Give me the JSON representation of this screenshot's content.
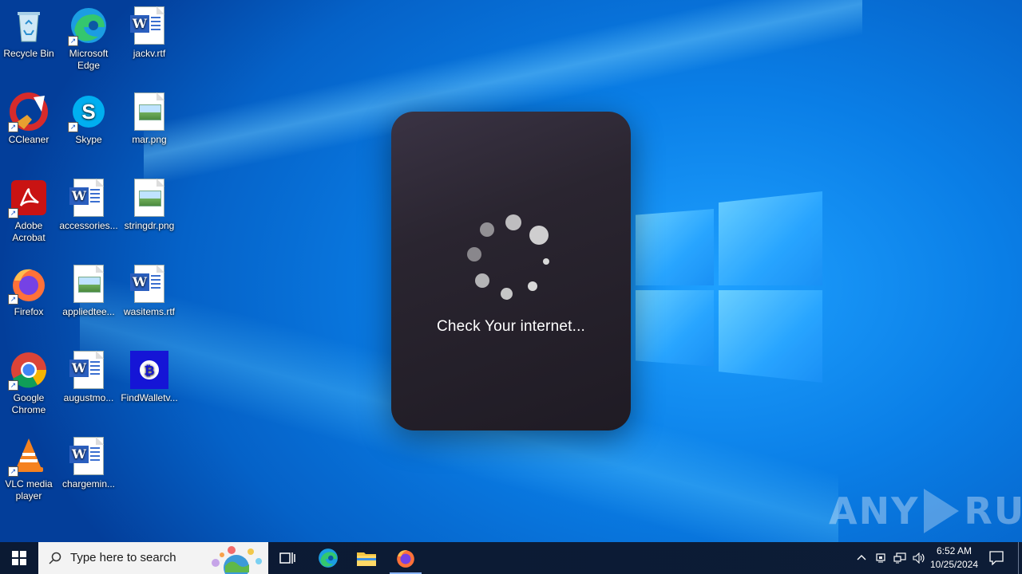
{
  "desktop": {
    "icons": [
      {
        "label": "Recycle Bin"
      },
      {
        "label": "Microsoft Edge"
      },
      {
        "label": "jackv.rtf"
      },
      {
        "label": "CCleaner"
      },
      {
        "label": "Skype"
      },
      {
        "label": "mar.png"
      },
      {
        "label": "Adobe Acrobat"
      },
      {
        "label": "accessories..."
      },
      {
        "label": "stringdr.png"
      },
      {
        "label": "Firefox"
      },
      {
        "label": "appliedtee..."
      },
      {
        "label": "wasitems.rtf"
      },
      {
        "label": "Google Chrome"
      },
      {
        "label": "augustmo..."
      },
      {
        "label": "FindWalletv..."
      },
      {
        "label": "VLC media player"
      },
      {
        "label": "chargemin..."
      }
    ]
  },
  "dialog": {
    "message": "Check Your internet..."
  },
  "watermark": {
    "left": "ANY",
    "right": "RUN"
  },
  "taskbar": {
    "search_placeholder": "Type here to search",
    "time": "6:52 AM",
    "date": "10/25/2024"
  },
  "colors": {
    "taskbar_bg": "#0d1c36",
    "dialog_bg": "#231f28",
    "desktop_accent": "#0a7ee6"
  }
}
